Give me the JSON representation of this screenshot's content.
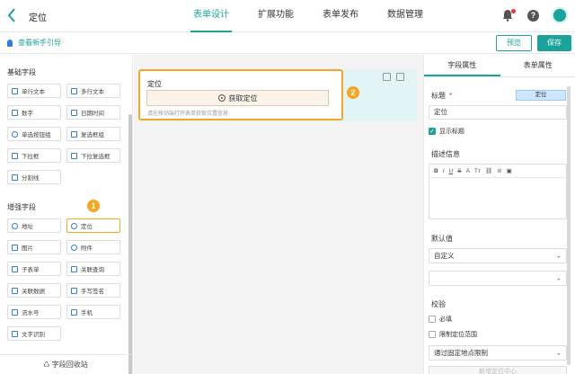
{
  "header": {
    "title": "定位",
    "tabs": [
      "表单设计",
      "扩展功能",
      "表单发布",
      "数据管理"
    ]
  },
  "subbar": {
    "guide": "查看新手引导",
    "preview": "预览",
    "save": "保存"
  },
  "left": {
    "basic_title": "基础字段",
    "basic": [
      "单行文本",
      "多行文本",
      "数字",
      "日期时间",
      "单选按钮组",
      "复选框组",
      "下拉框",
      "下拉复选框",
      "分割线"
    ],
    "enhanced_title": "增强字段",
    "enhanced": [
      "地址",
      "定位",
      "图片",
      "附件",
      "子表单",
      "关联查询",
      "关联数据",
      "手写签名",
      "流水号",
      "手机",
      "文字识别"
    ],
    "recycle": "字段回收站",
    "badge1": "1"
  },
  "canvas": {
    "label": "定位",
    "button": "获取定位",
    "hint": "请在移动端打开表单获取位置信息",
    "badge2": "2"
  },
  "right": {
    "tabs": [
      "字段属性",
      "表单属性"
    ],
    "title_label": "标题",
    "required_mark": "*",
    "title_tag": "定位",
    "title_value": "定位",
    "show_title": "显示标题",
    "desc_label": "描述信息",
    "toolbar": [
      "B",
      "I",
      "U",
      "S",
      "A",
      "Tт",
      "⛓",
      "⊘",
      "▣"
    ],
    "default_label": "默认值",
    "default_value": "自定义",
    "default_value2": "",
    "validate_label": "校验",
    "required": "必填",
    "limit_range": "限制定位范围",
    "limit_mode": "通过固定地点限制",
    "add_btn": "新增定位中心"
  }
}
